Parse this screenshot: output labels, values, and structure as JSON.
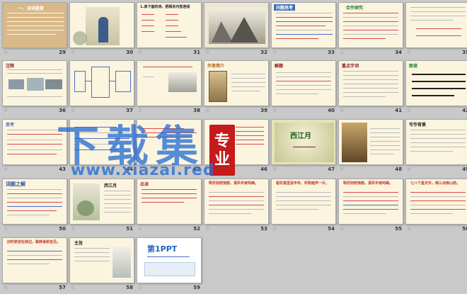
{
  "slides": [
    {
      "num": "29",
      "title": "一、诗词鉴赏"
    },
    {
      "num": "30",
      "title": ""
    },
    {
      "num": "31",
      "title": "1.读下面的诗，把相关内容连线"
    },
    {
      "num": "32",
      "title": ""
    },
    {
      "num": "33",
      "title": "问题思考"
    },
    {
      "num": "34",
      "title": "合作探究"
    },
    {
      "num": "35",
      "title": ""
    },
    {
      "num": "36",
      "title": "注释"
    },
    {
      "num": "37",
      "title": ""
    },
    {
      "num": "38",
      "title": ""
    },
    {
      "num": "39",
      "title": "作者简介"
    },
    {
      "num": "40",
      "title": "解题"
    },
    {
      "num": "41",
      "title": "重点字词"
    },
    {
      "num": "42",
      "title": "朗读"
    },
    {
      "num": "43",
      "title": "思考"
    },
    {
      "num": "44",
      "title": ""
    },
    {
      "num": "45",
      "title": ""
    },
    {
      "num": "46",
      "title": ""
    },
    {
      "num": "47",
      "title": "西江月"
    },
    {
      "num": "48",
      "title": ""
    },
    {
      "num": "49",
      "title": "写作背景"
    },
    {
      "num": "50",
      "title": "词题之解"
    },
    {
      "num": "51",
      "title": "西江月"
    },
    {
      "num": "52",
      "title": "品读"
    },
    {
      "num": "53",
      "title": "明月别枝惊鹊，清风半夜鸣蝉。"
    },
    {
      "num": "54",
      "title": "稻花香里说丰年，听取蛙声一片。"
    },
    {
      "num": "55",
      "title": "明月别枝惊鹊，清风半夜鸣蝉。"
    },
    {
      "num": "56",
      "title": "七八个星天外，两三点雨山前。"
    },
    {
      "num": "57",
      "title": "旧时茅店社林边，路转溪桥忽见。"
    },
    {
      "num": "58",
      "title": "主旨"
    },
    {
      "num": "59",
      "title": "第1PPT"
    }
  ],
  "watermark": {
    "main": "下载集",
    "url": "www.xiazai.red",
    "badge_line1": "专",
    "badge_line2": "业"
  },
  "colors": {
    "background": "#c9c9c9",
    "slide": "#fbf4df",
    "watermark": "#286ed2",
    "badge": "#c41b1b"
  }
}
